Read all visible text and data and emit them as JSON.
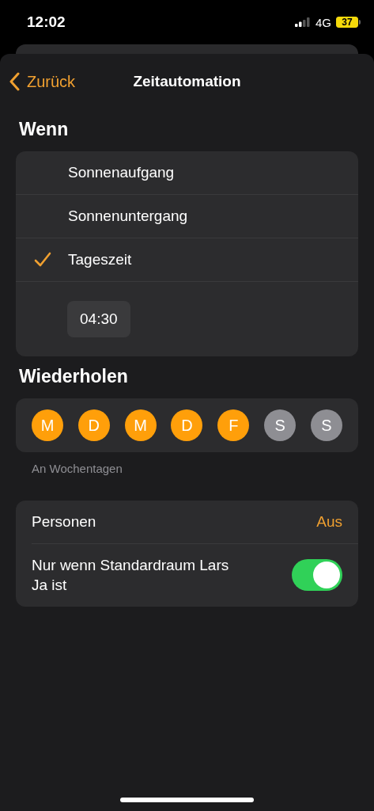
{
  "status_bar": {
    "time": "12:02",
    "network": "4G",
    "battery": "37"
  },
  "nav": {
    "back": "Zurück",
    "title": "Zeitautomation"
  },
  "when": {
    "heading": "Wenn",
    "options": [
      {
        "label": "Sonnenaufgang",
        "selected": false
      },
      {
        "label": "Sonnenuntergang",
        "selected": false
      },
      {
        "label": "Tageszeit",
        "selected": true
      }
    ],
    "time": "04:30"
  },
  "repeat": {
    "heading": "Wiederholen",
    "days": [
      {
        "label": "M",
        "selected": true
      },
      {
        "label": "D",
        "selected": true
      },
      {
        "label": "M",
        "selected": true
      },
      {
        "label": "D",
        "selected": true
      },
      {
        "label": "F",
        "selected": true
      },
      {
        "label": "S",
        "selected": false
      },
      {
        "label": "S",
        "selected": false
      }
    ],
    "footer": "An Wochentagen"
  },
  "conditions": [
    {
      "kind": "value",
      "label": "Personen",
      "value": "Aus"
    },
    {
      "kind": "toggle",
      "label": "Nur wenn Standardraum Lars Ja ist",
      "on": true
    }
  ]
}
